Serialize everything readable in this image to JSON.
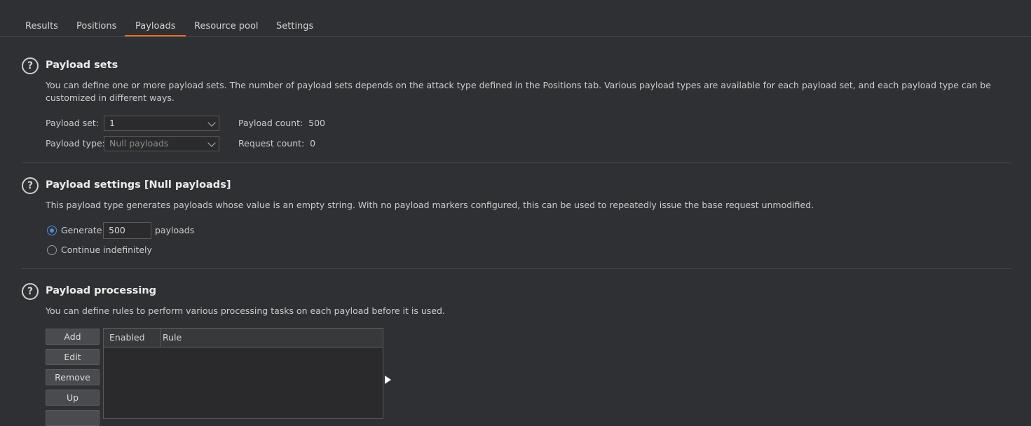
{
  "tabs": [
    "Results",
    "Positions",
    "Payloads",
    "Resource pool",
    "Settings"
  ],
  "payload_sets": {
    "title": "Payload sets",
    "description": "You can define one or more payload sets. The number of payload sets depends on the attack type defined in the Positions tab. Various payload types are available for each payload set, and each payload type can be customized in different ways.",
    "set_label": "Payload set:",
    "set_value": "1",
    "type_label": "Payload type:",
    "type_value": "Null payloads",
    "payload_count": "Payload count:  500",
    "request_count": "Request count:  0"
  },
  "payload_settings": {
    "title": "Payload settings [Null payloads]",
    "description": "This payload type generates payloads whose value is an empty string. With no payload markers configured, this can be used to repeatedly issue the base request unmodified.",
    "generate_label": "Generate",
    "generate_value": "500",
    "payloads_label": "payloads",
    "continue_label": "Continue indefinitely",
    "selected_option": "Generate"
  },
  "payload_processing": {
    "title": "Payload processing",
    "description": "You can define rules to perform various processing tasks on each payload before it is used.",
    "buttons": [
      "Add",
      "Edit",
      "Remove",
      "Up"
    ],
    "columns": [
      "Enabled",
      "Rule"
    ]
  },
  "colors": {
    "accent": "#e8702a",
    "radio": "#4a90d9",
    "background": "#2f3033"
  }
}
